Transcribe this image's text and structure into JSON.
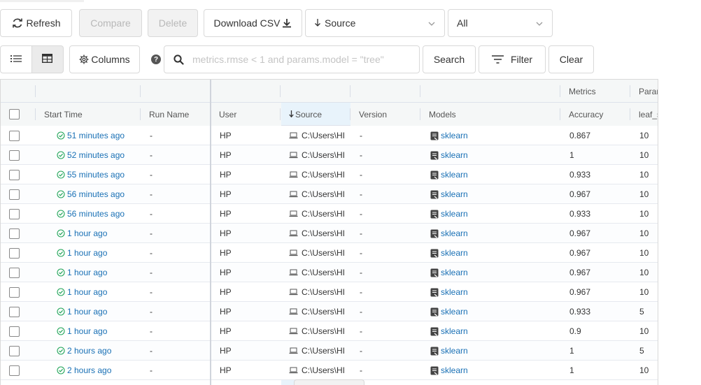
{
  "toolbar": {
    "refresh_label": "Refresh",
    "compare_label": "Compare",
    "delete_label": "Delete",
    "download_label": "Download CSV",
    "source_select": "Source",
    "all_select": "All"
  },
  "search": {
    "columns_label": "Columns",
    "help_glyph": "?",
    "placeholder": "metrics.rmse < 1 and params.model = \"tree\"",
    "search_label": "Search",
    "filter_label": "Filter",
    "clear_label": "Clear"
  },
  "table": {
    "group_headers": {
      "metrics": "Metrics",
      "params": "Parar"
    },
    "columns": {
      "start_time": "Start Time",
      "run_name": "Run Name",
      "user": "User",
      "source": "Source",
      "version": "Version",
      "models": "Models",
      "accuracy": "Accuracy",
      "leaf": "leaf_s"
    },
    "rows": [
      {
        "start": "51 minutes ago",
        "run": "-",
        "user": "HP",
        "source": "C:\\Users\\HI",
        "version": "-",
        "model": "sklearn",
        "accuracy": "0.867",
        "leaf": "10"
      },
      {
        "start": "52 minutes ago",
        "run": "-",
        "user": "HP",
        "source": "C:\\Users\\HI",
        "version": "-",
        "model": "sklearn",
        "accuracy": "1",
        "leaf": "10"
      },
      {
        "start": "55 minutes ago",
        "run": "-",
        "user": "HP",
        "source": "C:\\Users\\HI",
        "version": "-",
        "model": "sklearn",
        "accuracy": "0.933",
        "leaf": "10"
      },
      {
        "start": "56 minutes ago",
        "run": "-",
        "user": "HP",
        "source": "C:\\Users\\HI",
        "version": "-",
        "model": "sklearn",
        "accuracy": "0.967",
        "leaf": "10"
      },
      {
        "start": "56 minutes ago",
        "run": "-",
        "user": "HP",
        "source": "C:\\Users\\HI",
        "version": "-",
        "model": "sklearn",
        "accuracy": "0.933",
        "leaf": "10"
      },
      {
        "start": "1 hour ago",
        "run": "-",
        "user": "HP",
        "source": "C:\\Users\\HI",
        "version": "-",
        "model": "sklearn",
        "accuracy": "0.967",
        "leaf": "10"
      },
      {
        "start": "1 hour ago",
        "run": "-",
        "user": "HP",
        "source": "C:\\Users\\HI",
        "version": "-",
        "model": "sklearn",
        "accuracy": "0.967",
        "leaf": "10"
      },
      {
        "start": "1 hour ago",
        "run": "-",
        "user": "HP",
        "source": "C:\\Users\\HI",
        "version": "-",
        "model": "sklearn",
        "accuracy": "0.967",
        "leaf": "10"
      },
      {
        "start": "1 hour ago",
        "run": "-",
        "user": "HP",
        "source": "C:\\Users\\HI",
        "version": "-",
        "model": "sklearn",
        "accuracy": "0.967",
        "leaf": "10"
      },
      {
        "start": "1 hour ago",
        "run": "-",
        "user": "HP",
        "source": "C:\\Users\\HI",
        "version": "-",
        "model": "sklearn",
        "accuracy": "0.933",
        "leaf": "5"
      },
      {
        "start": "1 hour ago",
        "run": "-",
        "user": "HP",
        "source": "C:\\Users\\HI",
        "version": "-",
        "model": "sklearn",
        "accuracy": "0.9",
        "leaf": "10"
      },
      {
        "start": "2 hours ago",
        "run": "-",
        "user": "HP",
        "source": "C:\\Users\\HI",
        "version": "-",
        "model": "sklearn",
        "accuracy": "1",
        "leaf": "5"
      },
      {
        "start": "2 hours ago",
        "run": "-",
        "user": "HP",
        "source": "C:\\Users\\HI",
        "version": "-",
        "model": "sklearn",
        "accuracy": "1",
        "leaf": "10"
      }
    ]
  },
  "colors": {
    "link": "#1970b5",
    "success": "#23a65a",
    "sorted_column_bg": "#e8f3fb",
    "disabled_button_bg": "#f2f2f2"
  },
  "icons": {
    "refresh": "refresh-icon",
    "download": "download-icon",
    "sort": "arrow-down-icon",
    "list_view": "list-view-icon",
    "table_view": "table-view-icon",
    "columns": "gear-icon",
    "help": "question-icon",
    "search": "search-icon",
    "filter": "filter-icon",
    "status": "check-circle-icon",
    "source": "laptop-icon",
    "model": "model-icon"
  }
}
